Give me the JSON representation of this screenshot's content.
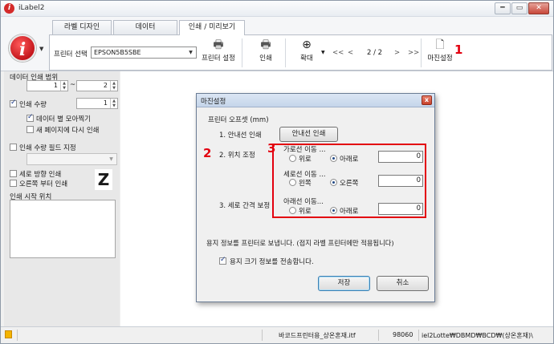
{
  "window": {
    "title": "iLabel2",
    "controls": {
      "minimize": "━",
      "restore": "▭",
      "close": "✕"
    }
  },
  "tabs": [
    {
      "label": "라벨 디자인"
    },
    {
      "label": "데이터"
    },
    {
      "label": "인쇄 / 미리보기"
    }
  ],
  "toolbar": {
    "printer_select_label": "프린터 선택",
    "printer_value": "EPSON5B5SBE",
    "printer_settings_label": "프린터 설정",
    "print_label": "인쇄",
    "zoom_label": "확대",
    "first_page": "<<",
    "prev_page": "<",
    "page_indicator": "2 / 2",
    "next_page": ">",
    "last_page": ">>",
    "margin_settings_label": "마진설정"
  },
  "annotations": {
    "one": "1",
    "two": "2",
    "three": "3"
  },
  "left_panel": {
    "data_print_range_label": "데이터 인쇄 범위",
    "range_from": "1",
    "range_sep": "~",
    "range_to": "2",
    "print_qty_label": "인쇄 수량",
    "print_qty_checked": true,
    "print_qty_value": "1",
    "collate_label": "데이터 별 모아찍기",
    "collate_checked": true,
    "new_page_label": "새 페이지에 다시 인쇄",
    "new_page_checked": false,
    "qty_field_label": "인쇄 수량 필드 지정",
    "qty_field_checked": false,
    "vertical_label": "세로 방향 인쇄",
    "vertical_checked": false,
    "from_right_label": "오른쪽 부터 인쇄",
    "from_right_checked": false,
    "z_icon": "Z",
    "start_position_label": "인쇄 시작 위치"
  },
  "dialog": {
    "title": "마진설정",
    "close": "x",
    "offset_label": "프린터 오프셋 (mm)",
    "step1_label": "1. 안내선 인쇄",
    "guide_print_button": "안내선 인쇄",
    "step2_label": "2. 위치 조정",
    "horizontal_move_label": "가로선 이동 ...",
    "up_label": "위로",
    "down_label": "아래로",
    "horizontal_value": "0",
    "horizontal_selected": "down",
    "vertical_move_label": "세로선 이동 ...",
    "left_label": "왼쪽",
    "right_label": "오른쪽",
    "vertical_value": "0",
    "vertical_selected": "right",
    "step3_label": "3. 세로 간격 보정",
    "bottom_move_label": "아래선 이동...",
    "bottom_value": "0",
    "bottom_selected": "down",
    "send_info_text": "용지 정보를 프린터로 보냅니다. (접지 라벨 프린터에만 적용됩니다)",
    "send_size_label": "용지 크기 정보를 전송합니다.",
    "send_size_checked": true,
    "save_button": "저장",
    "cancel_button": "취소"
  },
  "statusbar": {
    "file_name": "바코드프린터용_상온혼재.itf",
    "count": "98060",
    "path": "iel2Lotte₩DBMD₩BCD₩(상온혼재)\\"
  },
  "colors": {
    "accent_red": "#e3000f",
    "logo_red": "#c4161c"
  }
}
